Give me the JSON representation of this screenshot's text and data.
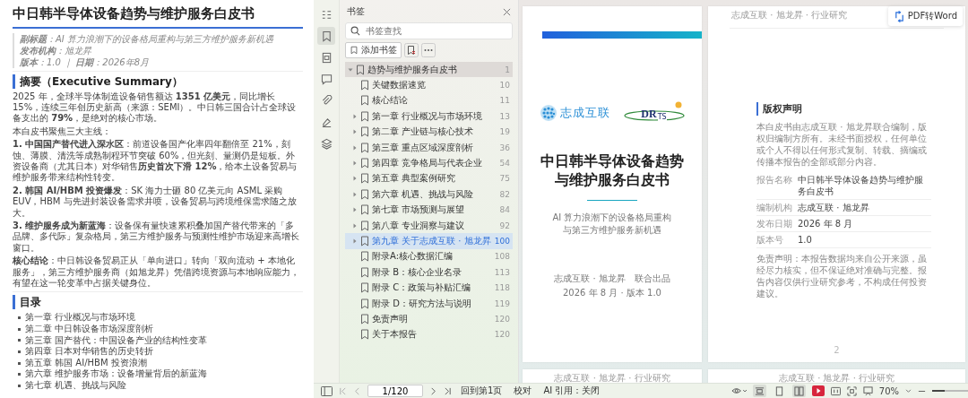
{
  "document": {
    "title": "中日韩半导体设备趋势与维护服务白皮书",
    "meta": [
      "**副标题**：AI 算力浪潮下的设备格局重构与第三方维护服务新机遇",
      "**发布机构**：旭龙昇",
      "**版本**：1.0 ｜ **日期**：2026年8月"
    ],
    "summary": {
      "heading": "摘要（Executive Summary）",
      "paragraphs": [
        "2025 年，全球半导体制造设备销售额达 **1351 亿美元**，同比增长 15%，连续三年创历史新高（来源：SEMI）。中日韩三国合计占全球设备支出的 **79%**，是绝对的核心市场。",
        "本白皮书聚焦三大主线：",
        "**1. 中国国产替代进入深水区**：前道设备国产化率四年翻倍至 21%，刻蚀、薄膜、清洗等成熟制程环节突破 60%，但光刻、量测仍是短板。外资设备商（尤其日本）对华销售**历史首次下滑 12%**，给本土设备贸易与维护服务带来结构性转变。",
        "**2. 韩国 AI/HBM 投资爆发**：SK 海力士砸 80 亿美元向 ASML 采购 EUV，HBM 与先进封装设备需求井喷，设备贸易与跨境维保需求随之放大。",
        "**3. 维护服务成为新蓝海**：设备保有量快速累积叠加国产替代带来的「多品牌、多代际」复杂格局，第三方维护服务与预测性维护市场迎来高增长窗口。",
        "**核心结论**：中日韩设备贸易正从「单向进口」转向「双向流动 + 本地化服务」，第三方维护服务商（如旭龙昇）凭借跨境资源与本地响应能力，有望在这一轮变革中占据关键身位。"
      ]
    },
    "toc": {
      "heading": "目录",
      "items": [
        "第一章 行业概况与市场环境",
        "第二章 中日韩设备市场深度剖析",
        "第三章 国产替代：中国设备产业的结构性变革",
        "第四章 日本对华销售的历史转折",
        "第五章 韩国 AI/HBM 投资浪潮",
        "第六章 维护服务市场：设备增量背后的新蓝海",
        "第七章 机遇、挑战与风险"
      ]
    }
  },
  "sidebar": {
    "tabs": [
      {
        "selected": false
      },
      {
        "selected": true
      },
      {
        "selected": false
      },
      {
        "selected": false
      },
      {
        "selected": false
      },
      {
        "selected": false
      },
      {
        "selected": false
      }
    ]
  },
  "bookmarks": {
    "title": "书签",
    "search": {
      "placeholder": "书签查找"
    },
    "add_button": "添加书签",
    "items": [
      {
        "kind": "root",
        "label": "趋势与维护服务白皮书",
        "page": "1",
        "expanded": true,
        "selected": false,
        "children": [
          {
            "kind": "leaf",
            "label": "关键数据速览",
            "page": "10",
            "selected": false
          },
          {
            "kind": "leaf",
            "label": "核心结论",
            "page": "11",
            "selected": false
          },
          {
            "kind": "chapter",
            "label": "第一章 行业概况与市场环境",
            "page": "13",
            "expanded": false,
            "selected": false
          },
          {
            "kind": "chapter",
            "label": "第二章 产业链与核心技术",
            "page": "19",
            "expanded": false,
            "selected": false
          },
          {
            "kind": "chapter",
            "label": "第三章 重点区域深度剖析",
            "page": "36",
            "expanded": false,
            "selected": false
          },
          {
            "kind": "chapter",
            "label": "第四章 竞争格局与代表企业",
            "page": "54",
            "expanded": false,
            "selected": false
          },
          {
            "kind": "chapter",
            "label": "第五章 典型案例研究",
            "page": "75",
            "expanded": false,
            "selected": false
          },
          {
            "kind": "chapter",
            "label": "第六章 机遇、挑战与风险",
            "page": "82",
            "expanded": false,
            "selected": false
          },
          {
            "kind": "chapter",
            "label": "第七章 市场预测与展望",
            "page": "84",
            "expanded": false,
            "selected": false
          },
          {
            "kind": "chapter",
            "label": "第八章 专业洞察与建议",
            "page": "92",
            "expanded": false,
            "selected": false
          },
          {
            "kind": "chapter",
            "label": "第九章 关于志成互联 · 旭龙昇",
            "page": "100",
            "expanded": false,
            "selected": true
          },
          {
            "kind": "leaf",
            "label": "附录A:核心数据汇编",
            "page": "108",
            "selected": false
          },
          {
            "kind": "leaf",
            "label": "附录 B：核心企业名录",
            "page": "113",
            "selected": false
          },
          {
            "kind": "leaf",
            "label": "附录 C：政策与补贴汇编",
            "page": "118",
            "selected": false
          },
          {
            "kind": "leaf",
            "label": "附录 D：研究方法与说明",
            "page": "119",
            "selected": false
          },
          {
            "kind": "leaf",
            "label": "免责声明",
            "page": "120",
            "selected": false
          },
          {
            "kind": "leaf",
            "label": "关于本报告",
            "page": "120",
            "selected": false
          }
        ]
      }
    ]
  },
  "cover": {
    "brand": "志成互联",
    "logo_text": "DR",
    "logo_sub": "TS",
    "title_lines": [
      "中日韩半导体设备趋势",
      "与维护服务白皮书"
    ],
    "subtitle_lines": [
      "AI 算力浪潮下的设备格局重构",
      "与第三方维护服务新机遇"
    ],
    "publisher": "志成互联 · 旭龙昇　联合出品",
    "date": "2026 年 8 月 · 版本 1.0"
  },
  "copyright_page": {
    "header": "志成互联 · 旭龙昇 · 行业研究",
    "heading": "版权声明",
    "paragraph": "本白皮书由志成互联 · 旭龙昇联合编制，版权归编制方所有。未经书面授权，任何单位或个人不得以任何形式复制、转载、摘编或传播本报告的全部或部分内容。",
    "rows": [
      {
        "label": "报告名称",
        "value": "中日韩半导体设备趋势与维护服务白皮书"
      },
      {
        "label": "编制机构",
        "value": "志成互联 · 旭龙昇"
      },
      {
        "label": "发布日期",
        "value": "2026 年 8 月"
      },
      {
        "label": "版本号",
        "value": "1.0"
      }
    ],
    "disclaimer": "免责声明：本报告数据均来自公开来源，虽经尽力核实，但不保证绝对准确与完整。报告内容仅供行业研究参考，不构成任何投资建议。",
    "page_number": "2"
  },
  "next_pages": [
    {
      "header": "志成互联 · 旭龙昇 · 行业研究"
    },
    {
      "header": "志成互联 · 旭龙昇 · 行业研究"
    }
  ],
  "pdf_button": "PDF转Word",
  "toolbar": {
    "page_input": "1/120",
    "back_button": "回到第1页",
    "proofread_button": "校对",
    "ai_cite": "AI 引用：关闭",
    "view_modes": [
      {
        "selected": true
      },
      {
        "selected": false
      },
      {
        "selected": true
      }
    ],
    "zoom": "70%",
    "zoom_slider": {
      "level": 0.35
    }
  }
}
